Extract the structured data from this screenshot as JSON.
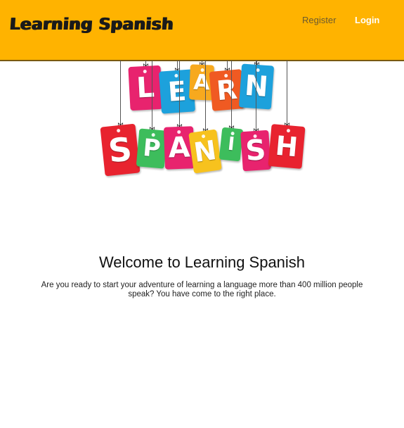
{
  "navbar": {
    "brand": "Learning Spanish",
    "register_label": "Register",
    "login_label": "Login",
    "bg_color": "#ffb300"
  },
  "hero": {
    "row1": [
      {
        "letter": "L",
        "color": "#e8236e"
      },
      {
        "letter": "E",
        "color": "#1da1dc"
      },
      {
        "letter": "A",
        "color": "#f7a91e"
      },
      {
        "letter": "R",
        "color": "#f05a22"
      },
      {
        "letter": "N",
        "color": "#1da1dc"
      }
    ],
    "row2": [
      {
        "letter": "S",
        "color": "#e8232f"
      },
      {
        "letter": "P",
        "color": "#3dbd5c"
      },
      {
        "letter": "A",
        "color": "#e8236e"
      },
      {
        "letter": "N",
        "color": "#f7c21e"
      },
      {
        "letter": "I",
        "color": "#3dbd5c"
      },
      {
        "letter": "S",
        "color": "#e8236e"
      },
      {
        "letter": "H",
        "color": "#e8232f"
      }
    ]
  },
  "main": {
    "title": "Welcome to Learning Spanish",
    "intro": "Are you ready to start your adventure of learning a language more than 400 million people speak? You have come to the right place."
  }
}
